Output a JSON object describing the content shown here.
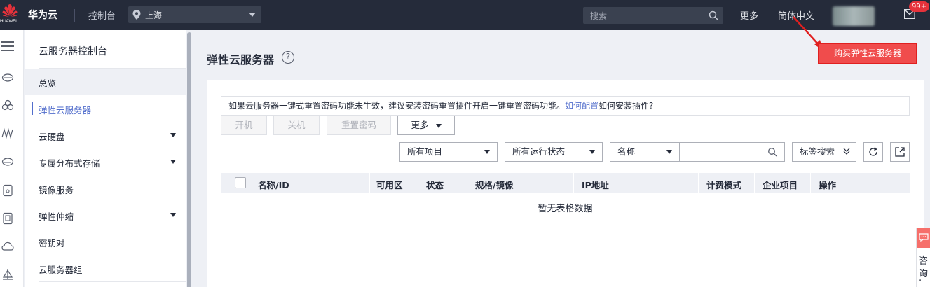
{
  "topbar": {
    "logo_text": "HUAWEI",
    "brand": "华为云",
    "console": "控制台",
    "region": "上海一",
    "search_placeholder": "搜索",
    "more": "更多",
    "language": "简体中文",
    "badge": "99+"
  },
  "sidebar": {
    "title": "云服务器控制台",
    "items": [
      {
        "label": "总览"
      },
      {
        "label": "弹性云服务器"
      },
      {
        "label": "云硬盘"
      },
      {
        "label": "专属分布式存储"
      },
      {
        "label": "镜像服务"
      },
      {
        "label": "弹性伸缩"
      },
      {
        "label": "密钥对"
      },
      {
        "label": "云服务器组"
      }
    ]
  },
  "main": {
    "title": "弹性云服务器",
    "buy_button": "购买弹性云服务器",
    "tip": {
      "text": "如果云服务器一键式重置密码功能未生效，建议安装密码重置插件开启一键重置密码功能。",
      "link": "如何配置",
      "suffix": "如何安装插件?"
    },
    "actions": {
      "start": "开机",
      "stop": "关机",
      "reset_password": "重置密码",
      "more": "更多"
    },
    "filters": {
      "project": "所有项目",
      "status": "所有运行状态",
      "field": "名称",
      "tag_search": "标签搜索"
    },
    "table": {
      "columns": [
        "名称/ID",
        "可用区",
        "状态",
        "规格/镜像",
        "IP地址",
        "计费模式",
        "企业项目",
        "操作"
      ],
      "empty": "暂无表格数据"
    }
  },
  "consult": {
    "label_1": "咨",
    "label_2": "询",
    "label_3": "·"
  },
  "colors": {
    "topbar": "#252b3a",
    "accent": "#526ecc",
    "buy": "#f04c4c",
    "huawei_red": "#e6323b"
  }
}
